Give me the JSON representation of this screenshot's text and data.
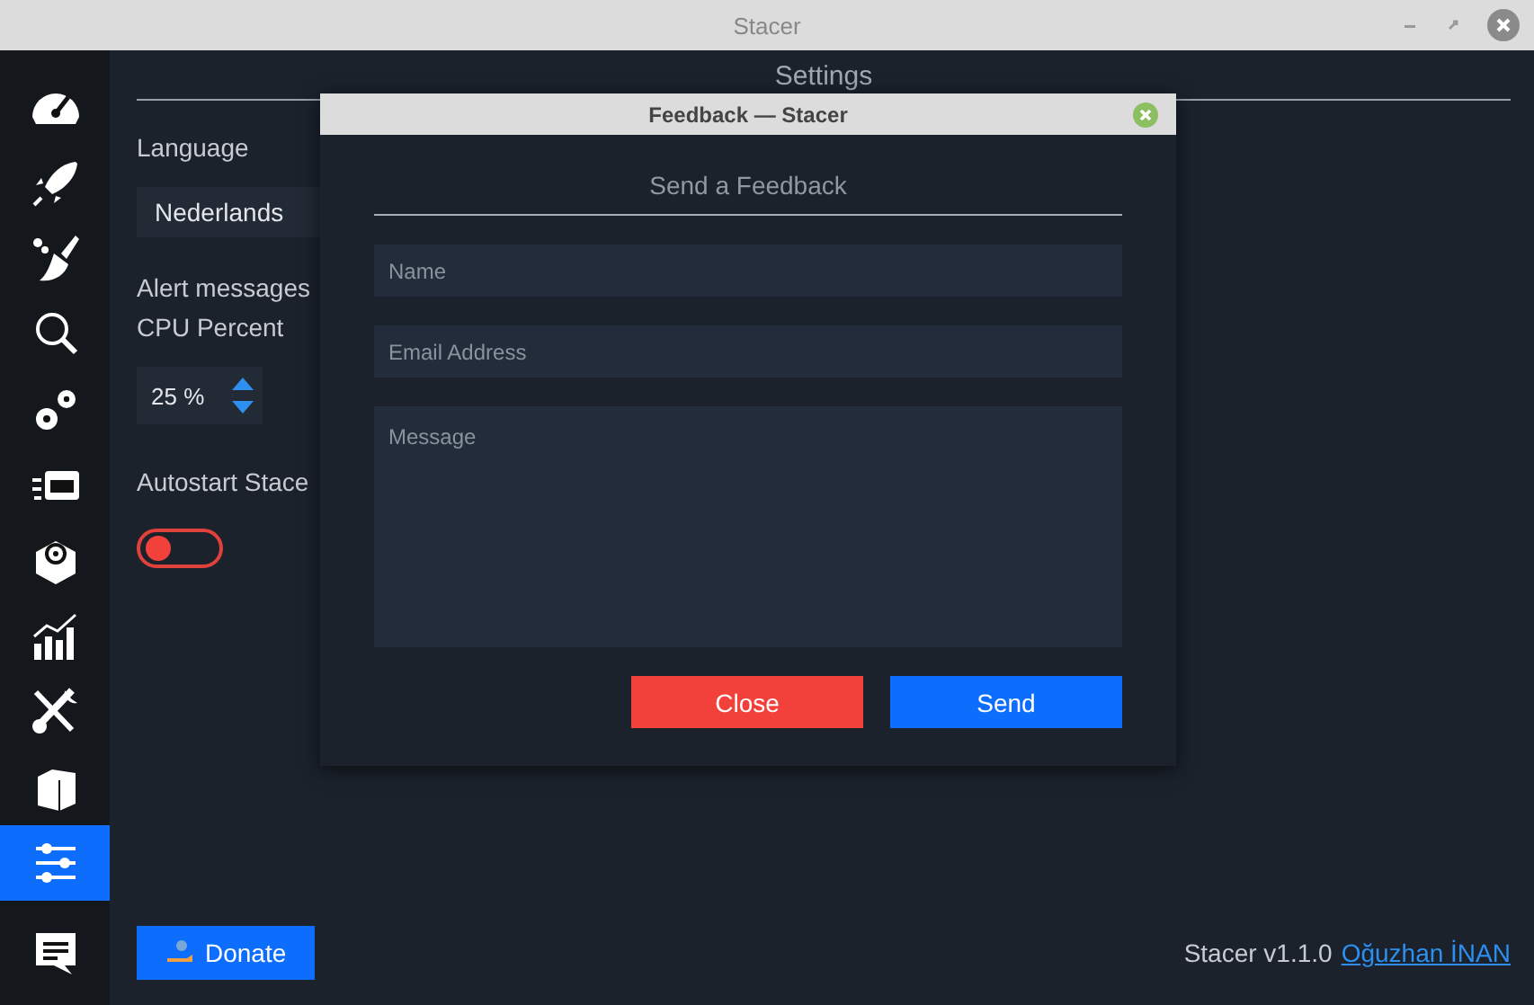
{
  "window": {
    "title": "Stacer"
  },
  "sidebar": {
    "items": [
      {
        "selected": false
      },
      {
        "selected": false
      },
      {
        "selected": false
      },
      {
        "selected": false
      },
      {
        "selected": false
      },
      {
        "selected": false
      },
      {
        "selected": false
      },
      {
        "selected": false
      },
      {
        "selected": false
      },
      {
        "selected": false
      },
      {
        "selected": true
      },
      {
        "selected": false
      }
    ]
  },
  "settings": {
    "title": "Settings",
    "language_label": "Language",
    "language_value": "Nederlands",
    "alert_label": "Alert messages",
    "cpu_label": "CPU Percent",
    "cpu_value": "25 %",
    "autostart_label": "Autostart Stace",
    "autostart_on": false
  },
  "donate_button": "Donate",
  "footer": {
    "version": "Stacer v1.1.0",
    "author_link": "Oğuzhan İNAN"
  },
  "dialog": {
    "title": "Feedback — Stacer",
    "heading": "Send a Feedback",
    "fields": [
      {
        "placeholder": "Name",
        "kind": "line"
      },
      {
        "placeholder": "Email Address",
        "kind": "line"
      },
      {
        "placeholder": "Message",
        "kind": "area"
      }
    ],
    "buttons": [
      {
        "label": "Close",
        "kind": "danger"
      },
      {
        "label": "Send",
        "kind": "primary"
      }
    ]
  }
}
